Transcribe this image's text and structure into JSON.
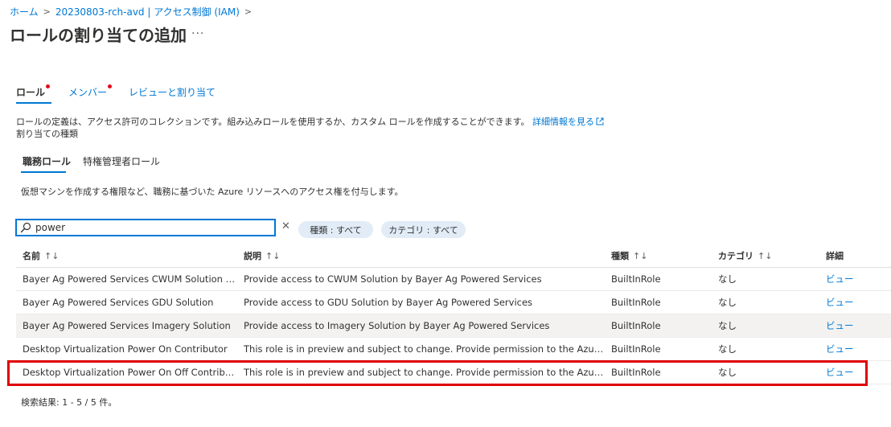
{
  "breadcrumb": {
    "items": [
      "ホーム",
      "20230803-rch-avd | アクセス制御 (IAM)"
    ],
    "separator": ">"
  },
  "page": {
    "title": "ロールの割り当ての追加",
    "more_label": "···"
  },
  "tabs": [
    {
      "label": "ロール",
      "required": true,
      "selected": true
    },
    {
      "label": "メンバー",
      "required": true,
      "selected": false
    },
    {
      "label": "レビューと割り当て",
      "required": false,
      "selected": false
    }
  ],
  "description": {
    "text": "ロールの定義は、アクセス許可のコレクションです。組み込みロールを使用するか、カスタム ロールを作成することができます。",
    "learn_more": "詳細情報を見る",
    "assignment_type_label": "割り当ての種類"
  },
  "subtabs": [
    {
      "label": "職務ロール",
      "selected": true
    },
    {
      "label": "特権管理者ロール",
      "selected": false
    }
  ],
  "subtab_description": "仮想マシンを作成する権限など、職務に基づいた Azure リソースへのアクセス権を付与します。",
  "search": {
    "value": "power",
    "placeholder": ""
  },
  "filters": [
    {
      "label": "種類 : すべて"
    },
    {
      "label": "カテゴリ : すべて"
    }
  ],
  "table": {
    "columns": [
      {
        "label": "名前",
        "sort": "↑↓"
      },
      {
        "label": "説明",
        "sort": "↑↓"
      },
      {
        "label": "種類",
        "sort": "↑↓"
      },
      {
        "label": "カテゴリ",
        "sort": "↑↓"
      },
      {
        "label": "詳細",
        "sort": ""
      }
    ],
    "rows": [
      {
        "name": "Bayer Ag Powered Services CWUM Solution Servic...",
        "description": "Provide access to CWUM Solution by Bayer Ag Powered Services",
        "type": "BuiltInRole",
        "category": "なし",
        "detail": "ビュー"
      },
      {
        "name": "Bayer Ag Powered Services GDU Solution",
        "description": "Provide access to GDU Solution by Bayer Ag Powered Services",
        "type": "BuiltInRole",
        "category": "なし",
        "detail": "ビュー"
      },
      {
        "name": "Bayer Ag Powered Services Imagery Solution",
        "description": "Provide access to Imagery Solution by Bayer Ag Powered Services",
        "type": "BuiltInRole",
        "category": "なし",
        "detail": "ビュー"
      },
      {
        "name": "Desktop Virtualization Power On Contributor",
        "description": "This role is in preview and subject to change. Provide permission to the Azure Virtual ...",
        "type": "BuiltInRole",
        "category": "なし",
        "detail": "ビュー"
      },
      {
        "name": "Desktop Virtualization Power On Off Contributor",
        "description": "This role is in preview and subject to change. Provide permission to the Azure Virtual ...",
        "type": "BuiltInRole",
        "category": "なし",
        "detail": "ビュー"
      }
    ]
  },
  "results_summary": "検索結果: 1 - 5 / 5 件。",
  "colors": {
    "accent": "#0078d4",
    "highlight_box": "#e00000",
    "required_dot": "#e00b1c",
    "pill_bg": "#e1ecf7"
  }
}
